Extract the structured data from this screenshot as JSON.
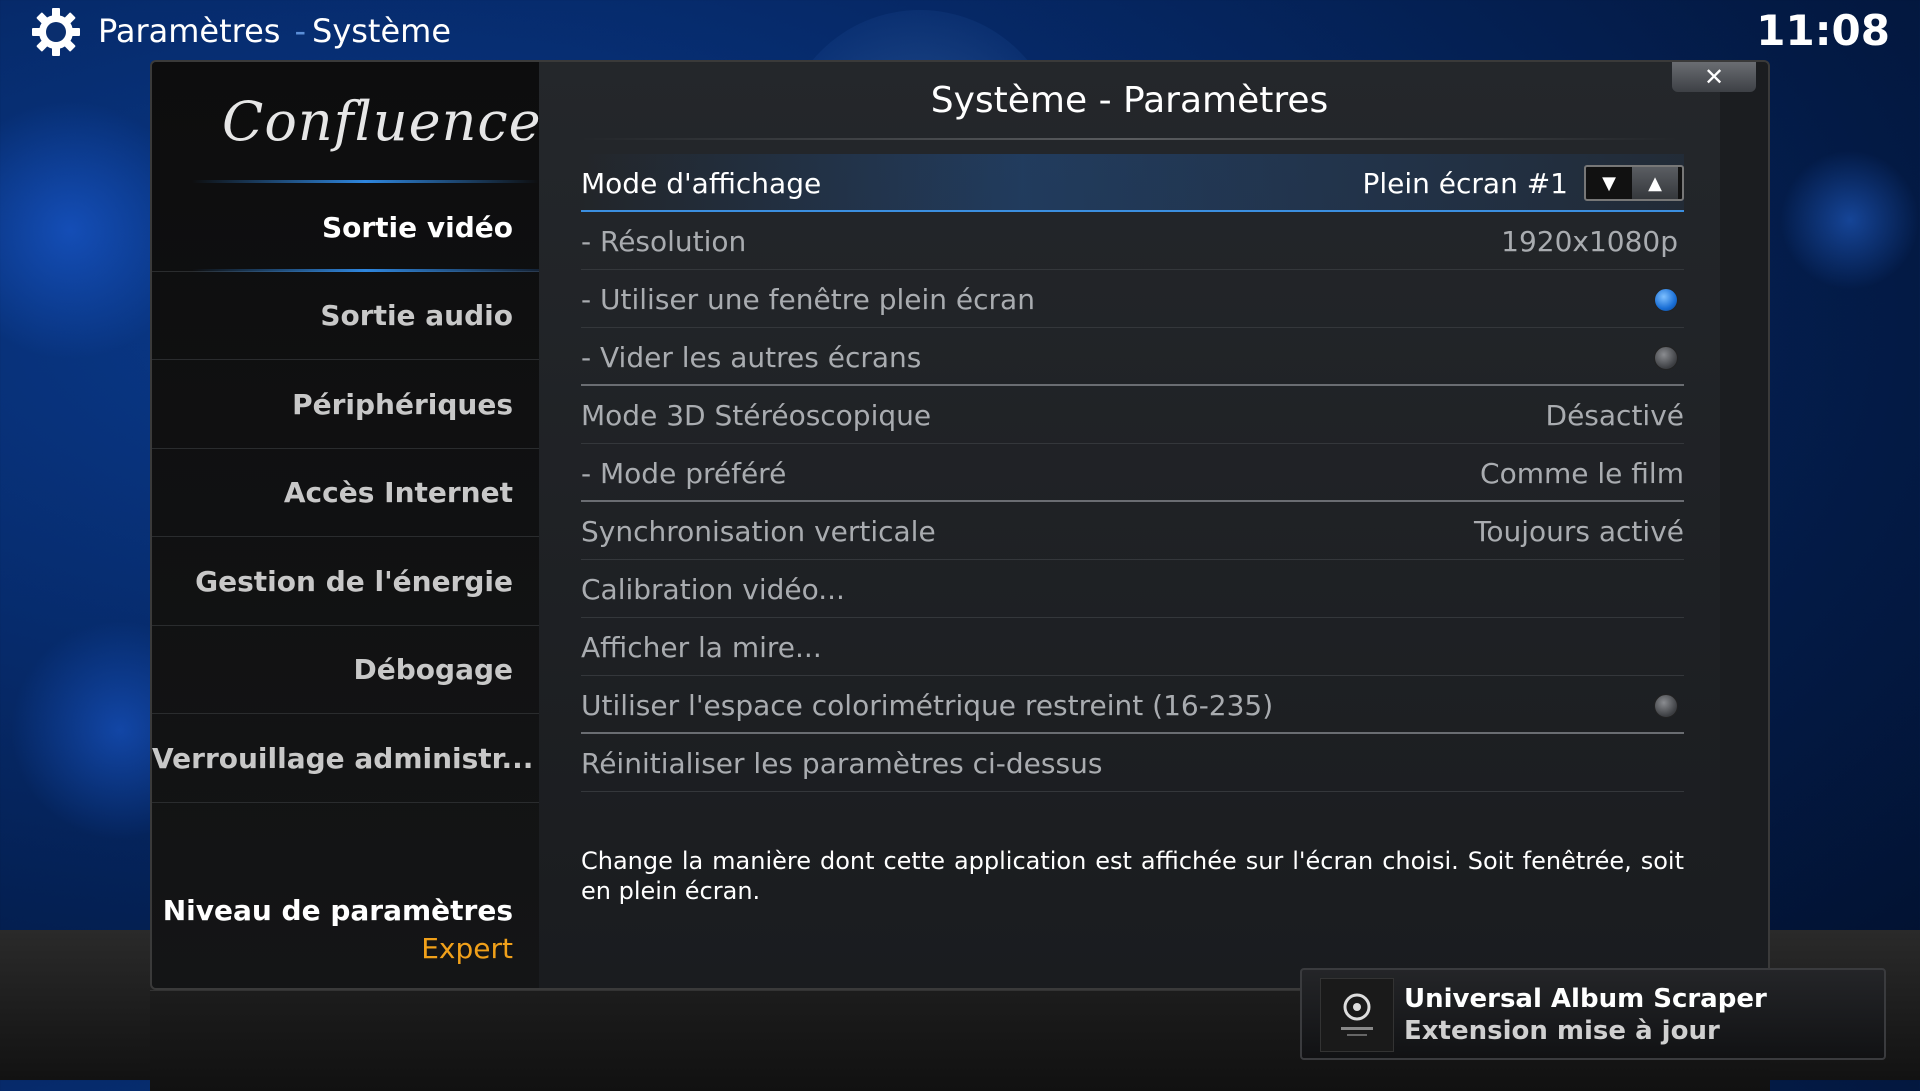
{
  "topbar": {
    "section": "Paramètres",
    "separator": "-",
    "page": "Système",
    "clock": "11:08"
  },
  "skin_logo": "Confluence",
  "sidebar": {
    "items": [
      {
        "label": "Sortie vidéo",
        "active": true
      },
      {
        "label": "Sortie audio",
        "active": false
      },
      {
        "label": "Périphériques",
        "active": false
      },
      {
        "label": "Accès Internet",
        "active": false
      },
      {
        "label": "Gestion de l'énergie",
        "active": false
      },
      {
        "label": "Débogage",
        "active": false
      },
      {
        "label": "Verrouillage administr...",
        "active": false
      }
    ],
    "level_label": "Niveau de paramètres",
    "level_value": "Expert"
  },
  "dialog": {
    "title": "Système - Paramètres",
    "close_label": "✕"
  },
  "settings": [
    {
      "label": "Mode d'affichage",
      "value": "Plein écran #1",
      "control": "spinner"
    },
    {
      "label": "- Résolution",
      "value": "1920x1080p"
    },
    {
      "label": "- Utiliser une fenêtre plein écran",
      "control": "radio",
      "checked": true
    },
    {
      "label": "- Vider les autres écrans",
      "control": "radio",
      "checked": false
    },
    {
      "label": "Mode 3D Stéréoscopique",
      "value": "Désactivé"
    },
    {
      "label": "- Mode préféré",
      "value": "Comme le film"
    },
    {
      "label": "Synchronisation verticale",
      "value": "Toujours activé"
    },
    {
      "label": "Calibration vidéo..."
    },
    {
      "label": "Afficher la mire..."
    },
    {
      "label": "Utiliser l'espace colorimétrique restreint (16-235)",
      "control": "radio",
      "checked": false
    },
    {
      "label": "Réinitialiser les paramètres ci-dessus"
    }
  ],
  "spinner": {
    "down": "▼",
    "up": "▲"
  },
  "description": "Change la manière dont cette application est affichée sur l'écran choisi. Soit fenêtrée, soit en plein écran.",
  "toast": {
    "title": "Universal Album Scraper",
    "subtitle": "Extension mise à jour"
  },
  "colors": {
    "accent": "#2e86de",
    "level_value": "#f0a01a",
    "background": "#062a6a"
  },
  "icons": [
    "gear-icon",
    "close-icon",
    "arrow-down-icon",
    "arrow-up-icon",
    "back-icon",
    "home-icon",
    "addon-icon"
  ]
}
